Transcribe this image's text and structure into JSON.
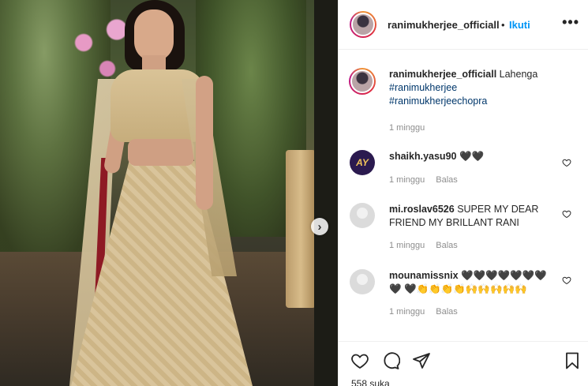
{
  "post": {
    "username": "ranimukherjee_officiall",
    "separator": "•",
    "follow_label": "Ikuti",
    "more_label": "•••",
    "next_arrow": "›"
  },
  "caption": {
    "username": "ranimukherjee_officiall",
    "text": "Lahenga",
    "hashtags": [
      "#ranimukherjee",
      "#ranimukherjeechopra"
    ],
    "time": "1 minggu"
  },
  "comments": [
    {
      "username": "shaikh.yasu90",
      "text": "🖤🖤",
      "time": "1 minggu",
      "reply_label": "Balas",
      "avatar_text": "AY"
    },
    {
      "username": "mi.roslav6526",
      "text": "SUPER MY DEAR FRIEND MY BRILLANT RANI",
      "time": "1 minggu",
      "reply_label": "Balas",
      "avatar_text": ""
    },
    {
      "username": "mounamissnix",
      "text": "🖤🖤🖤🖤🖤🖤🖤🖤 🖤👏👏👏👏🙌🙌🙌🙌🙌",
      "time": "1 minggu",
      "reply_label": "Balas",
      "avatar_text": ""
    }
  ],
  "likes": "558 suka",
  "colors": {
    "link": "#0095f6",
    "hashtag": "#00376b",
    "meta": "#8e8e8e"
  },
  "icons": [
    "heart-icon",
    "comment-icon",
    "share-icon",
    "bookmark-icon",
    "more-icon",
    "chevron-right-icon"
  ]
}
